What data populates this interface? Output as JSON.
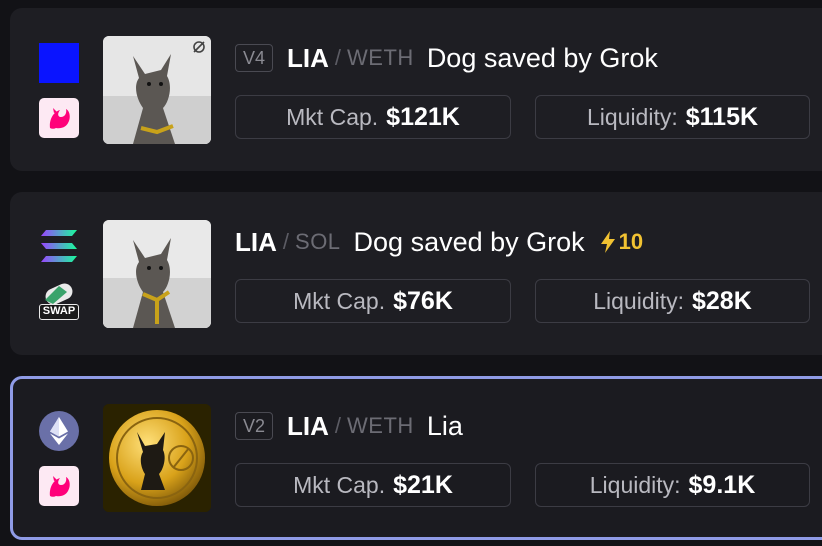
{
  "pairs": [
    {
      "version": "V4",
      "symbol": "LIA",
      "quote": "WETH",
      "name": "Dog saved by Grok",
      "chain_icon": "blue-square-icon",
      "dex_icon": "uniswap-icon",
      "mkt_cap_label": "Mkt Cap.",
      "mkt_cap_value": "$121K",
      "liquidity_label": "Liquidity:",
      "liquidity_value": "$115K"
    },
    {
      "symbol": "LIA",
      "quote": "SOL",
      "name": "Dog saved by Grok",
      "boost": "10",
      "chain_icon": "solana-icon",
      "dex_icon": "swap-icon",
      "dex_icon_text": "SWAP",
      "mkt_cap_label": "Mkt Cap.",
      "mkt_cap_value": "$76K",
      "liquidity_label": "Liquidity:",
      "liquidity_value": "$28K"
    },
    {
      "version": "V2",
      "symbol": "LIA",
      "quote": "WETH",
      "name": "Lia",
      "chain_icon": "ethereum-icon",
      "dex_icon": "uniswap-icon",
      "mkt_cap_label": "Mkt Cap.",
      "mkt_cap_value": "$21K",
      "liquidity_label": "Liquidity:",
      "liquidity_value": "$9.1K",
      "selected": true
    }
  ],
  "colors": {
    "background": "#121216",
    "card": "#1e1e23",
    "selected_border": "#8f9be6",
    "boost": "#f1c232",
    "uniswap_pink": "#ff007a"
  }
}
